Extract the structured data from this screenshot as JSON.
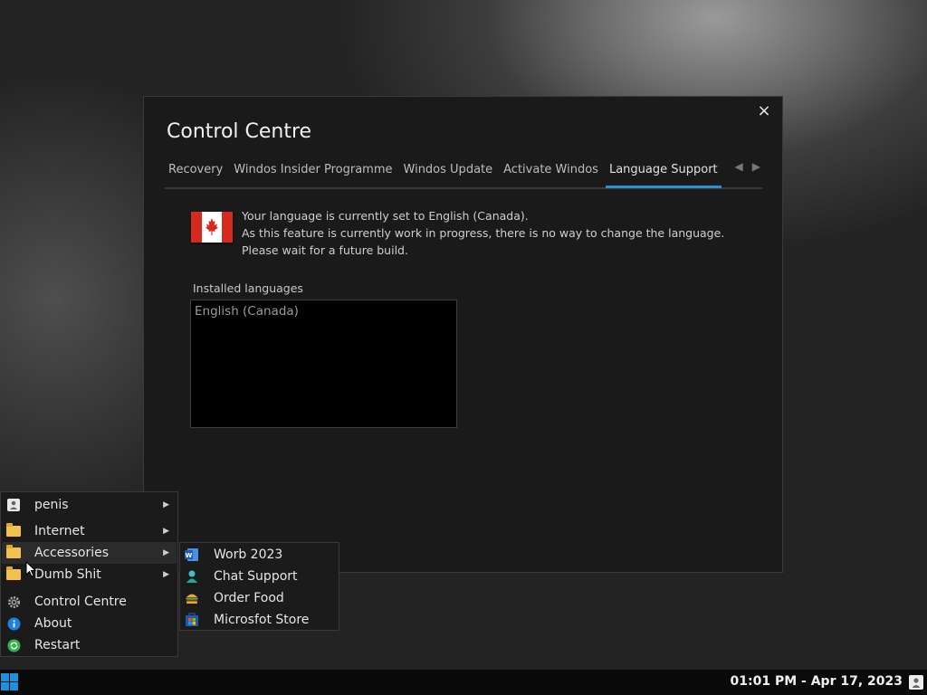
{
  "window": {
    "title": "Control Centre",
    "close_label": "×",
    "tabs": [
      {
        "label": "Recovery"
      },
      {
        "label": "Windos Insider Programme"
      },
      {
        "label": "Windos Update"
      },
      {
        "label": "Activate Windos"
      },
      {
        "label": "Language Support",
        "active": true
      }
    ],
    "tab_prev": "◀",
    "tab_next": "▶",
    "message_lines": [
      "Your language is currently set to English (Canada).",
      "As this feature is currently work in progress, there is no way to change the language.",
      "Please wait for a future build."
    ],
    "installed_label": "Installed languages",
    "languages": [
      "English (Canada)"
    ]
  },
  "start_menu": {
    "items": [
      {
        "label": "penis",
        "icon": "user-icon",
        "submenu": true
      },
      {
        "label": "Internet",
        "icon": "folder-icon",
        "submenu": true
      },
      {
        "label": "Accessories",
        "icon": "folder-icon",
        "submenu": true,
        "hover": true
      },
      {
        "label": "Dumb Shit",
        "icon": "folder-icon",
        "submenu": true
      },
      {
        "label": "Control Centre",
        "icon": "gear-icon"
      },
      {
        "label": "About",
        "icon": "info-icon"
      },
      {
        "label": "Restart",
        "icon": "restart-icon"
      }
    ],
    "accessories": [
      {
        "label": "Worb 2023",
        "icon": "word-icon"
      },
      {
        "label": "Chat Support",
        "icon": "person-icon"
      },
      {
        "label": "Order Food",
        "icon": "burger-icon"
      },
      {
        "label": "Microsfot Store",
        "icon": "store-icon"
      }
    ]
  },
  "taskbar": {
    "clock": "01:01 PM - Apr 17, 2023"
  },
  "colors": {
    "accent": "#2a8fd0",
    "flag_red": "#d52b1e"
  }
}
